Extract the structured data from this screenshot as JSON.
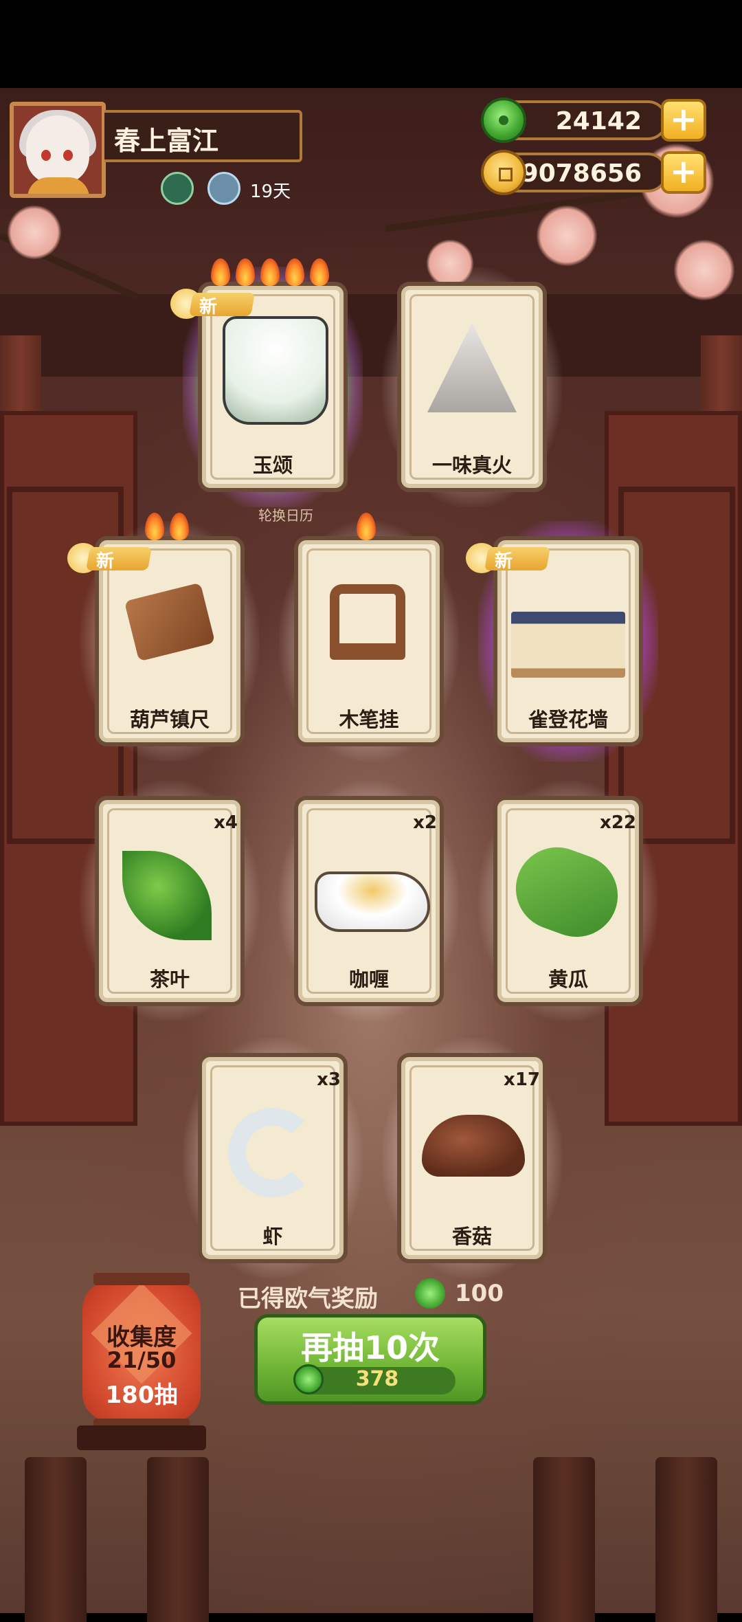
{
  "player": {
    "name": "春上富江",
    "days": "19天",
    "status_icons": [
      "pet-icon",
      "bowl-icon"
    ]
  },
  "currencies": {
    "jade": "24142",
    "gold": "9078656",
    "jade_icon": "jade-coin-icon",
    "gold_icon": "gold-coin-icon"
  },
  "center_sign": "轮换日历",
  "cards": [
    {
      "label": "玉颂",
      "count": "",
      "new": "新",
      "flames": 5,
      "glow": "rainbow",
      "art": "jade-cup-icon"
    },
    {
      "label": "一味真火",
      "count": "",
      "new": "",
      "flames": 0,
      "glow": "white",
      "art": "fire-emblem-icon"
    },
    {
      "label": "葫芦镇尺",
      "count": "",
      "new": "新",
      "flames": 2,
      "glow": "white",
      "art": "paperweight-icon"
    },
    {
      "label": "木笔挂",
      "count": "",
      "new": "",
      "flames": 1,
      "glow": "white",
      "art": "brush-rack-icon"
    },
    {
      "label": "雀登花墙",
      "count": "",
      "new": "新",
      "flames": 0,
      "glow": "purple",
      "art": "flower-wall-icon"
    },
    {
      "label": "茶叶",
      "count": "x4",
      "new": "",
      "flames": 0,
      "glow": "white",
      "art": "tea-leaf-icon"
    },
    {
      "label": "咖喱",
      "count": "x2",
      "new": "",
      "flames": 0,
      "glow": "white",
      "art": "curry-icon"
    },
    {
      "label": "黄瓜",
      "count": "x22",
      "new": "",
      "flames": 0,
      "glow": "white",
      "art": "cucumber-icon"
    },
    {
      "label": "虾",
      "count": "x3",
      "new": "",
      "flames": 0,
      "glow": "white",
      "art": "shrimp-icon"
    },
    {
      "label": "香菇",
      "count": "x17",
      "new": "",
      "flames": 0,
      "glow": "white",
      "art": "mushroom-icon"
    }
  ],
  "reward": {
    "text": "已得欧气奖励",
    "value": "100"
  },
  "redraw": {
    "label": "再抽10次",
    "cost": "378"
  },
  "collection": {
    "title": "收集度",
    "progress": "21/50",
    "draws": "180抽"
  },
  "colors": {
    "card_bg": "#f4ead2",
    "button_green": "#6fb535",
    "flame": "#ff8a2a",
    "lantern_red": "#d1472c"
  }
}
